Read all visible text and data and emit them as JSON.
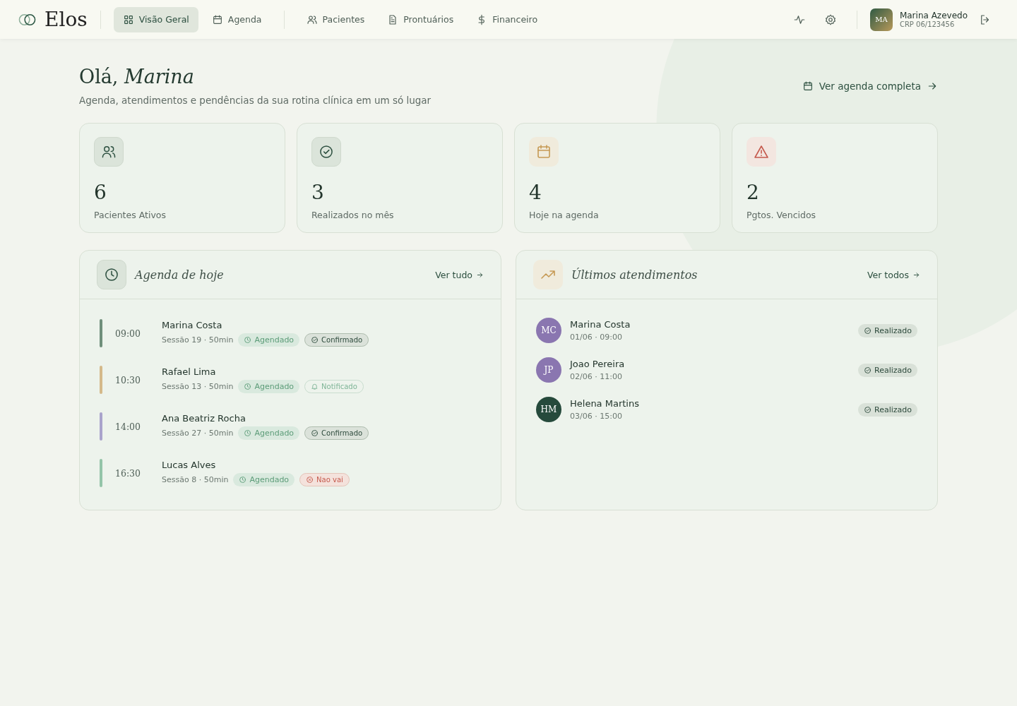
{
  "brand": "Elos",
  "nav": [
    {
      "label": "Visão Geral",
      "kind": "grid",
      "selected": true
    },
    {
      "label": "Agenda",
      "kind": "calendar",
      "selected": false
    },
    {
      "label": "Pacientes",
      "kind": "users",
      "selected": false
    },
    {
      "label": "Prontuários",
      "kind": "file",
      "selected": false
    },
    {
      "label": "Financeiro",
      "kind": "dollar",
      "selected": false
    }
  ],
  "user": {
    "initials": "MA",
    "name": "Marina Azevedo",
    "reg": "CRP 06/123456"
  },
  "greeting": "Olá, *Marina*",
  "subtitle": "Agenda, atendimentos e pendências da sua rotina clínica em um só lugar",
  "agenda_link": "Ver agenda completa",
  "stats": [
    {
      "kind": "users",
      "value": "6",
      "label": "Pacientes Ativos"
    },
    {
      "kind": "check",
      "value": "3",
      "label": "Realizados no mês"
    },
    {
      "kind": "calendar",
      "value": "4",
      "label": "Hoje na agenda"
    },
    {
      "kind": "alert",
      "value": "2",
      "label": "Pgtos. Vencidos"
    }
  ],
  "today": {
    "title": "Agenda de hoje",
    "link": "Ver tudo",
    "items": [
      {
        "time": "09:00",
        "name": "Marina Costa",
        "session": "Sessão 19 · 50min",
        "color": "#6f8f7b",
        "tags": [
          {
            "kind": "scheduled",
            "label": "Agendado"
          },
          {
            "kind": "confirmed",
            "label": "Confirmado"
          }
        ]
      },
      {
        "time": "10:30",
        "name": "Rafael Lima",
        "session": "Sessão 13 · 50min",
        "color": "#d4b98a",
        "tags": [
          {
            "kind": "scheduled",
            "label": "Agendado"
          },
          {
            "kind": "notified",
            "label": "Notificado"
          }
        ]
      },
      {
        "time": "14:00",
        "name": "Ana Beatriz Rocha",
        "session": "Sessão 27 · 50min",
        "color": "#a9a3cc",
        "tags": [
          {
            "kind": "scheduled",
            "label": "Agendado"
          },
          {
            "kind": "confirmed",
            "label": "Confirmado"
          }
        ]
      },
      {
        "time": "16:30",
        "name": "Lucas Alves",
        "session": "Sessão 8 · 50min",
        "color": "#94c4a8",
        "tags": [
          {
            "kind": "scheduled",
            "label": "Agendado"
          },
          {
            "kind": "declined",
            "label": "Nao vai"
          }
        ]
      }
    ]
  },
  "recent": {
    "title": "Últimos atendimentos",
    "link": "Ver todos",
    "items": [
      {
        "initials": "MC",
        "name": "Marina Costa",
        "when": "01/06 · 09:00",
        "status": "Realizado",
        "color": "#8a76b0"
      },
      {
        "initials": "JP",
        "name": "Joao Pereira",
        "when": "02/06 · 11:00",
        "status": "Realizado",
        "color": "#8a76b0"
      },
      {
        "initials": "HM",
        "name": "Helena Martins",
        "when": "03/06 · 15:00",
        "status": "Realizado",
        "color": "#264a3c"
      }
    ]
  }
}
